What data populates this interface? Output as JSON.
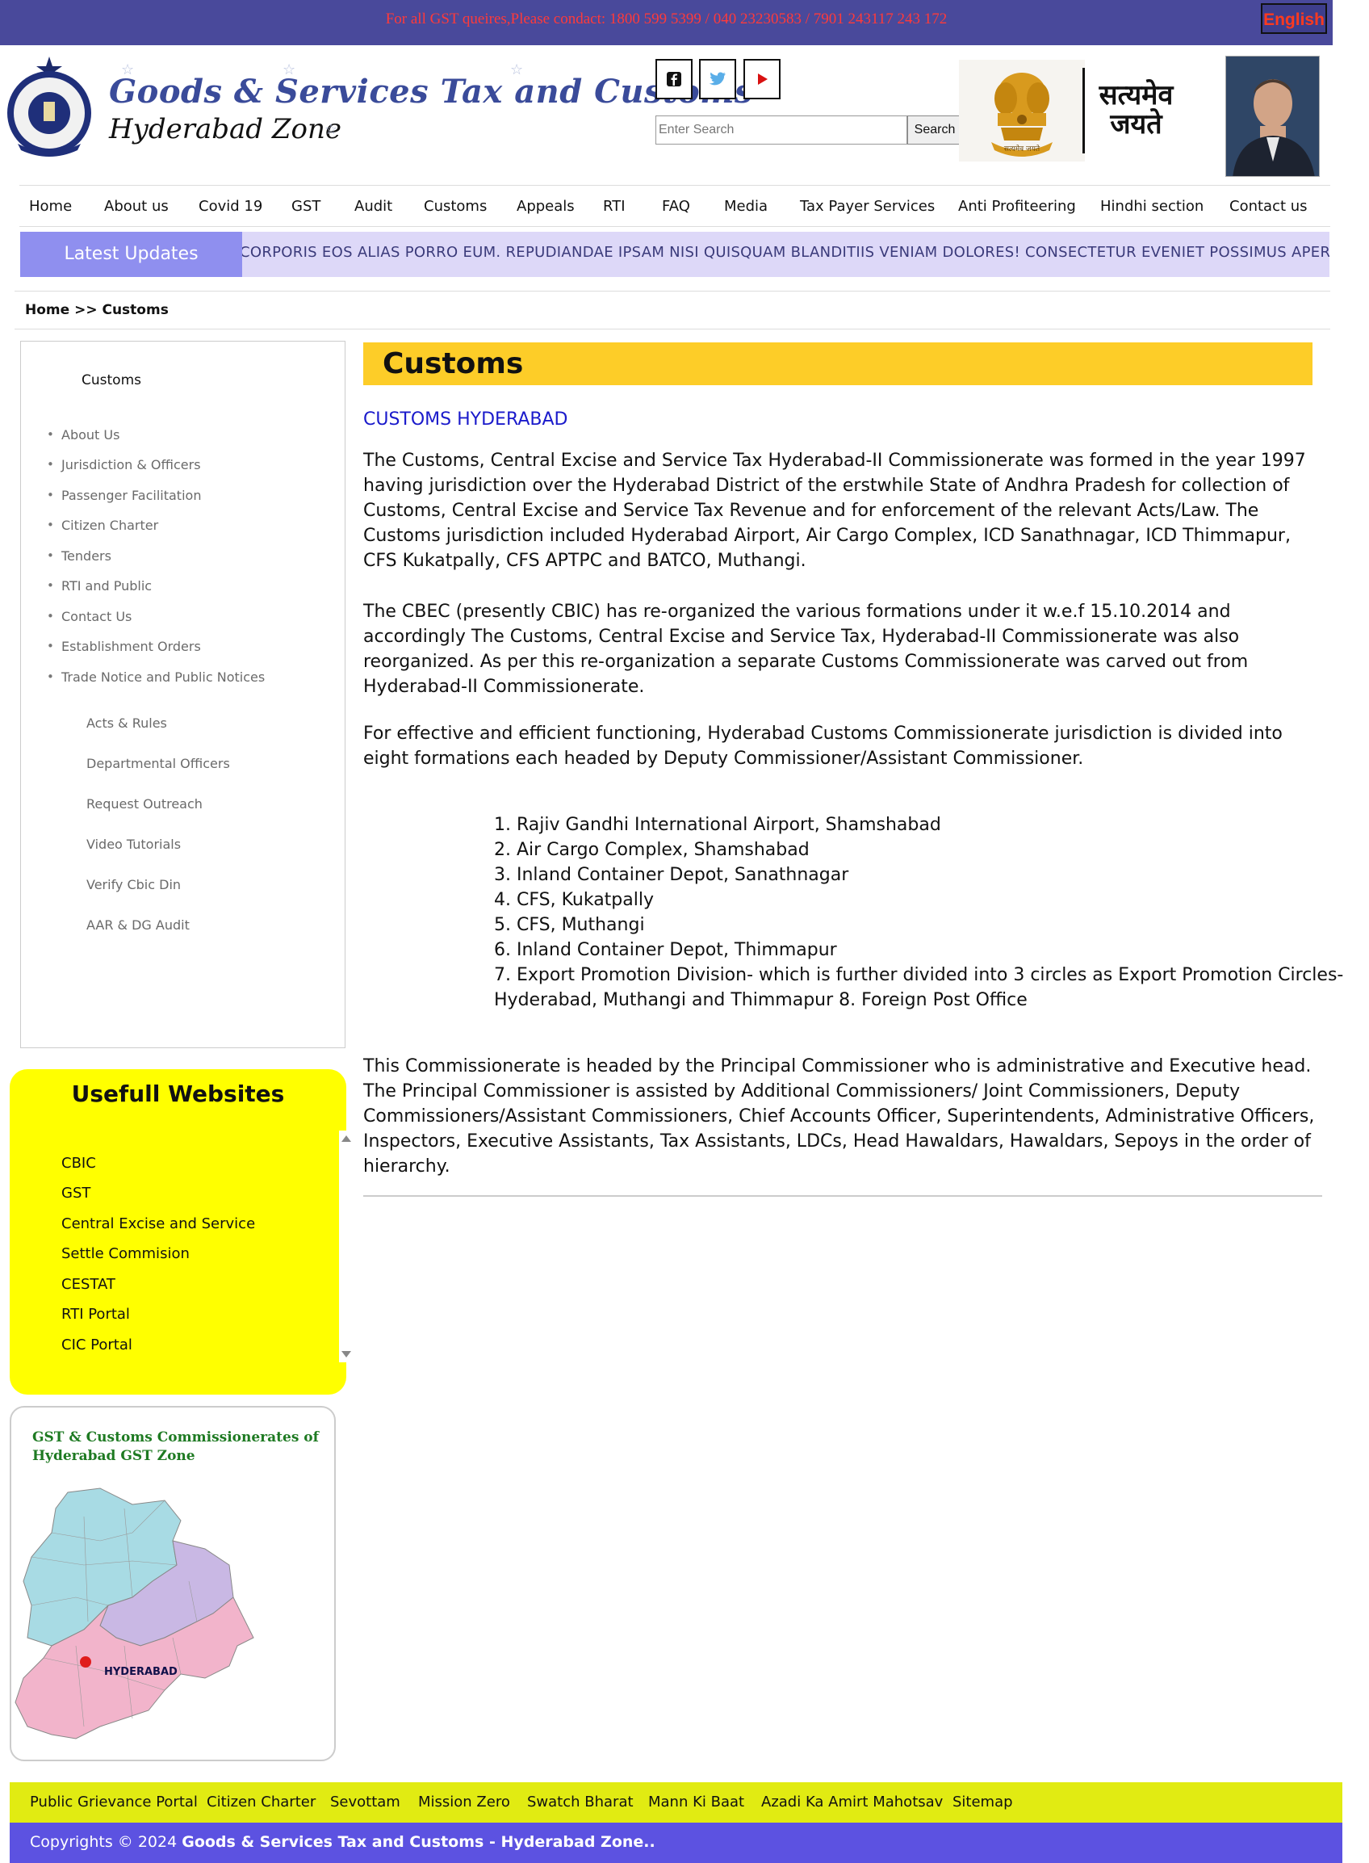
{
  "topbar": {
    "contact": "For all GST queires,Please condact: 1800 599 5399 / 040 23230583 / 7901 243117 243 172",
    "language": "English"
  },
  "header": {
    "brand_line1": "Goods & Services Tax and Customs",
    "brand_line2": "Hyderabad Zone",
    "search_placeholder": "Enter Search",
    "search_button": "Search",
    "motto_line1": "सत्यमेव",
    "motto_line2": "जयते",
    "emblem_text": "सत्यमेव जयते"
  },
  "nav": [
    "Home",
    "About us",
    "Covid 19",
    "GST",
    "Audit",
    "Customs",
    "Appeals",
    "RTI",
    "FAQ",
    "Media",
    "Tax Payer Services",
    "Anti Profiteering",
    "Hindhi section",
    "Contact us"
  ],
  "ticker": {
    "label": "Latest Updates",
    "text": "CORPORIS EOS ALIAS PORRO EUM. REPUDIANDAE IPSAM NISI QUISQUAM BLANDITIIS VENIAM DOLORES! CONSECTETUR EVENIET POSSIMUS APERIAM Q"
  },
  "breadcrumb": "Home >> Customs",
  "sidebar": {
    "title": "Customs",
    "bullets": [
      "About Us",
      "Jurisdiction & Officers",
      "Passenger Facilitation",
      "Citizen Charter",
      "Tenders",
      "RTI and Public",
      "Contact Us",
      "Establishment Orders",
      "Trade Notice and Public Notices"
    ],
    "links": [
      "Acts & Rules",
      "Departmental Officers",
      "Request Outreach",
      "Video Tutorials",
      "Verify Cbic Din",
      "AAR & DG Audit"
    ]
  },
  "useful": {
    "title": "Usefull Websites",
    "items": [
      "CBIC",
      "GST",
      "Central Excise and Service",
      "Settle Commision",
      "CESTAT",
      "RTI Portal",
      "CIC Portal"
    ]
  },
  "mapbox": {
    "title": "GST & Customs Commissionerates of Hyderabad GST Zone",
    "map_label": "HYDERABAD"
  },
  "main": {
    "title": "Customs",
    "subhead": "CUSTOMS HYDERABAD",
    "p1": "The Customs, Central Excise and Service Tax Hyderabad-II Commissionerate was formed in the year 1997 having jurisdiction over the Hyderabad District of the erstwhile State of Andhra Pradesh for collection of Customs, Central Excise and Service Tax Revenue and for enforcement of the relevant Acts/Law. The Customs jurisdiction included Hyderabad Airport, Air Cargo Complex, ICD Sanathnagar, ICD Thimmapur, CFS Kukatpally, CFS APTPC and BATCO, Muthangi.",
    "p2": "The CBEC (presently CBIC) has re-organized the various formations under it w.e.f 15.10.2014 and accordingly The Customs, Central Excise and Service Tax, Hyderabad-II Commissionerate was also reorganized. As per this re-organization a separate Customs Commissionerate was carved out from Hyderabad-II Commissionerate.",
    "p3": "For effective and efficient functioning, Hyderabad Customs Commissionerate jurisdiction is divided into eight formations each headed by Deputy Commissioner/Assistant Commissioner.",
    "list": [
      "1. Rajiv Gandhi International Airport, Shamshabad",
      "2. Air Cargo Complex, Shamshabad",
      "3. Inland Container Depot, Sanathnagar",
      "4. CFS, Kukatpally",
      "5. CFS, Muthangi",
      "6. Inland Container Depot, Thimmapur",
      "7. Export Promotion Division- which is further divided into 3 circles as Export Promotion Circles-",
      "Hyderabad, Muthangi and Thimmapur 8. Foreign Post Office"
    ],
    "p4": "This Commissionerate is headed by the Principal Commissioner who is administrative and Executive head. The Principal Commissioner is assisted by Additional Commissioners/ Joint Commissioners, Deputy Commissioners/Assistant Commissioners, Chief Accounts Officer, Superintendents, Administrative Officers, Inspectors, Executive Assistants, Tax Assistants, LDCs, Head Hawaldars, Hawaldars, Sepoys in the order of hierarchy."
  },
  "footer": {
    "links": [
      "Public Grievance Portal",
      "Citizen Charter",
      "Sevottam",
      "Mission Zero",
      "Swatch Bharat",
      "Mann Ki Baat",
      "Azadi Ka Amirt Mahotsav",
      "Sitemap"
    ],
    "copyright_prefix": "Copyrights © 2024",
    "copyright_bold": "Goods & Services Tax and Customs - Hyderabad Zone.."
  },
  "colors": {
    "topbar": "#49499b",
    "brand": "#3a4b9a",
    "ticker_label": "#8f8fef",
    "ticker_bg": "#ddd8f8",
    "title_bar": "#fdcd28",
    "useful_bg": "#ffff00",
    "footer_links_bg": "#e1eb12",
    "copyright_bg": "#5c52e1"
  }
}
